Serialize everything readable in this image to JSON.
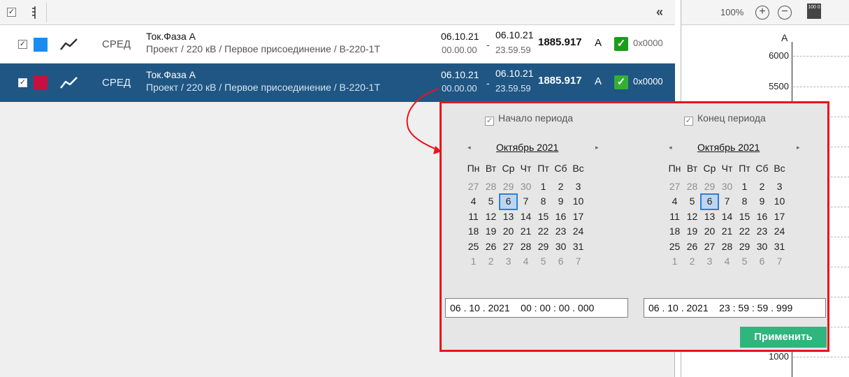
{
  "toolbar": {
    "select_all_checked": true,
    "collapse_label": "«"
  },
  "rows": [
    {
      "checked": true,
      "color": "#1a8cf0",
      "type": "СРЕД",
      "name": "Ток.Фаза А",
      "path": "Проект / 220 кВ / Первое присоединение / В-220-1Т",
      "start_date": "06.10.21",
      "start_time": "00.00.00",
      "end_date": "06.10.21",
      "end_time": "23.59.59",
      "value": "1885.917",
      "unit": "А",
      "code": "0x0000"
    },
    {
      "checked": true,
      "color": "#c8103e",
      "type": "СРЕД",
      "name": "Ток.Фаза А",
      "path": "Проект / 220 кВ / Первое присоединение / В-220-1Т",
      "start_date": "06.10.21",
      "start_time": "00.00.00",
      "end_date": "06.10.21",
      "end_time": "23.59.59",
      "value": "1885.917",
      "unit": "А",
      "code": "0x0000"
    }
  ],
  "separator": "-",
  "chart_panel": {
    "zoom": "100%",
    "zoom_in_label": "+",
    "zoom_out_label": "−",
    "fit_label": "100 0",
    "y_unit": "А",
    "ticks": [
      "6000",
      "5500",
      "1000"
    ]
  },
  "popup": {
    "start_checkbox_label": "Начало периода",
    "end_checkbox_label": "Конец периода",
    "prev_arrow": "◂",
    "next_arrow": "▸",
    "start_calendar": {
      "month": "Октябрь 2021",
      "weekdays": [
        "Пн",
        "Вт",
        "Ср",
        "Чт",
        "Пт",
        "Сб",
        "Вс"
      ],
      "days": [
        "27",
        "28",
        "29",
        "30",
        "1",
        "2",
        "3",
        "4",
        "5",
        "6",
        "7",
        "8",
        "9",
        "10",
        "11",
        "12",
        "13",
        "14",
        "15",
        "16",
        "17",
        "18",
        "19",
        "20",
        "21",
        "22",
        "23",
        "24",
        "25",
        "26",
        "27",
        "28",
        "29",
        "30",
        "31",
        "1",
        "2",
        "3",
        "4",
        "5",
        "6",
        "7"
      ],
      "selected": "6"
    },
    "end_calendar": {
      "month": "Октябрь 2021",
      "weekdays": [
        "Пн",
        "Вт",
        "Ср",
        "Чт",
        "Пт",
        "Сб",
        "Вс"
      ],
      "days": [
        "27",
        "28",
        "29",
        "30",
        "1",
        "2",
        "3",
        "4",
        "5",
        "6",
        "7",
        "8",
        "9",
        "10",
        "11",
        "12",
        "13",
        "14",
        "15",
        "16",
        "17",
        "18",
        "19",
        "20",
        "21",
        "22",
        "23",
        "24",
        "25",
        "26",
        "27",
        "28",
        "29",
        "30",
        "31",
        "1",
        "2",
        "3",
        "4",
        "5",
        "6",
        "7"
      ],
      "selected": "6"
    },
    "start_value": "06 . 10 . 2021    00 : 00 : 00 . 000",
    "end_value": "06 . 10 . 2021    23 : 59 : 59 . 999",
    "apply_label": "Применить"
  },
  "colors": {
    "selected_row": "#1f5684",
    "popup_border": "#e8141e",
    "apply_button": "#2fb57d"
  }
}
